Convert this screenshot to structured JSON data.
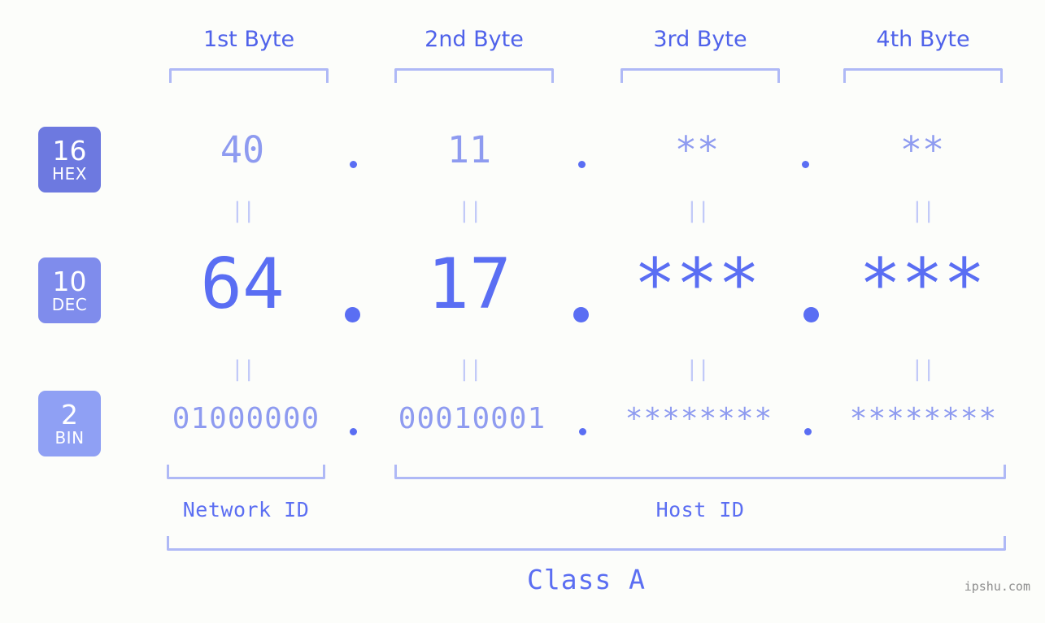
{
  "background_color": "#fcfdfa",
  "accent_colors": {
    "bright_blue": "#5a6ef3",
    "mid_blue": "#8e9bf0",
    "light_blue": "#afb9f6",
    "pale_blue": "#c2caf8",
    "badge_hex": "#6d79e0",
    "badge_dec": "#7f8cec",
    "badge_bin": "#8fa0f4",
    "watermark_gray": "#8d8d8d"
  },
  "byte_headers": [
    {
      "label": "1st Byte"
    },
    {
      "label": "2nd Byte"
    },
    {
      "label": "3rd Byte"
    },
    {
      "label": "4th Byte"
    }
  ],
  "radix_badges": [
    {
      "number": "16",
      "name": "HEX"
    },
    {
      "number": "10",
      "name": "DEC"
    },
    {
      "number": "2",
      "name": "BIN"
    }
  ],
  "rows": {
    "hex": {
      "values": [
        "40",
        "11",
        "**",
        "**"
      ],
      "separator": "."
    },
    "dec": {
      "values": [
        "64",
        "17",
        "***",
        "***"
      ],
      "separator": "."
    },
    "bin": {
      "values": [
        "01000000",
        "00010001",
        "********",
        "********"
      ],
      "separator": "."
    }
  },
  "equality_marks": {
    "glyph": "||",
    "count_per_row": 4
  },
  "segments": {
    "network_id_label": "Network ID",
    "host_id_label": "Host ID"
  },
  "class_label": "Class A",
  "watermark": "ipshu.com"
}
